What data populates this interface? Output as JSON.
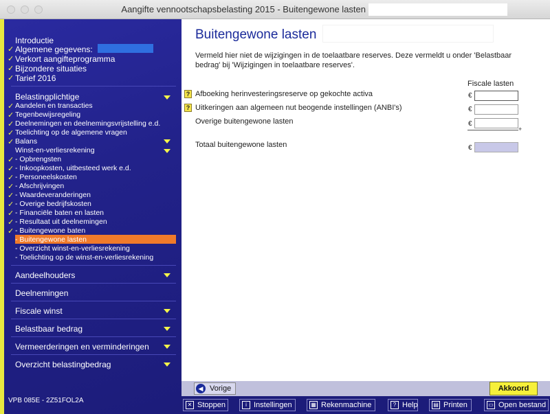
{
  "window": {
    "title": "Aangifte vennootschapsbelasting 2015 - Buitengewone lasten"
  },
  "sidebar": {
    "top_items": [
      {
        "label": "Introductie",
        "checked": false
      },
      {
        "label": "Algemene gegevens:",
        "checked": true
      },
      {
        "label": "Verkort aangifteprogramma",
        "checked": true
      },
      {
        "label": "Bijzondere situaties",
        "checked": true
      },
      {
        "label": "Tarief 2016",
        "checked": true
      }
    ],
    "section1_header": "Belastingplichtige",
    "section1_items": [
      {
        "label": "Aandelen en transacties",
        "checked": true
      },
      {
        "label": "Tegenbewijsregeling",
        "checked": true
      },
      {
        "label": "Deelnemingen en deelnemingsvrijstelling e.d.",
        "checked": true
      },
      {
        "label": "Toelichting op de algemene vragen",
        "checked": true
      },
      {
        "label": "Balans",
        "checked": true
      }
    ],
    "wv_header": "Winst-en-verliesrekening",
    "wv_items": [
      {
        "label": "- Opbrengsten",
        "checked": true
      },
      {
        "label": "- Inkoopkosten, uitbesteed werk e.d.",
        "checked": true
      },
      {
        "label": "- Personeelskosten",
        "checked": true
      },
      {
        "label": "- Afschrijvingen",
        "checked": true
      },
      {
        "label": "- Waardeveranderingen",
        "checked": true
      },
      {
        "label": "- Overige bedrijfskosten",
        "checked": true
      },
      {
        "label": "- Financiële baten en lasten",
        "checked": true
      },
      {
        "label": "- Resultaat uit deelnemingen",
        "checked": true
      },
      {
        "label": "- Buitengewone baten",
        "checked": true
      },
      {
        "label": "- Buitengewone lasten",
        "checked": false,
        "selected": true
      },
      {
        "label": "- Overzicht winst-en-verliesrekening",
        "checked": false
      },
      {
        "label": "- Toelichting op de winst-en-verliesrekening",
        "checked": false
      }
    ],
    "sections": [
      {
        "label": "Aandeelhouders"
      },
      {
        "label": "Deelnemingen"
      },
      {
        "label": "Fiscale winst"
      },
      {
        "label": "Belastbaar bedrag"
      },
      {
        "label": "Vermeerderingen en verminderingen"
      },
      {
        "label": "Overzicht belastingbedrag"
      }
    ],
    "version": "VPB 085E - 2Z51FOL2A"
  },
  "main": {
    "title": "Buitengewone lasten",
    "intro": "Vermeld hier niet de wijzigingen in de toelaatbare reserves. Deze vermeldt u onder 'Belastbaar bedrag' bij 'Wijzigingen in toelaatbare reserves'.",
    "column_header": "Fiscale lasten",
    "help_symbol": "?",
    "currency": "€",
    "rows": [
      {
        "label": "Afboeking herinvesteringsreserve op gekochte activa",
        "value": ""
      },
      {
        "label": "Uitkeringen aan algemeen nut beogende instellingen (ANBI's)",
        "value": ""
      },
      {
        "label": "Overige buitengewone lasten",
        "value": ""
      }
    ],
    "sum_symbol": "+",
    "total_label": "Totaal buitengewone lasten"
  },
  "nav": {
    "previous_label": "Vorige",
    "confirm_label": "Akkoord"
  },
  "toolbar": {
    "stop": "Stoppen",
    "settings": "Instellingen",
    "calculator": "Rekenmachine",
    "help": "Help",
    "print": "Printen",
    "open": "Open bestand"
  },
  "colors": {
    "sidebar_bg": "#22228a",
    "accent_yellow": "#f5f54a",
    "selected": "#f07a2a",
    "title_blue": "#1a2a9a"
  }
}
